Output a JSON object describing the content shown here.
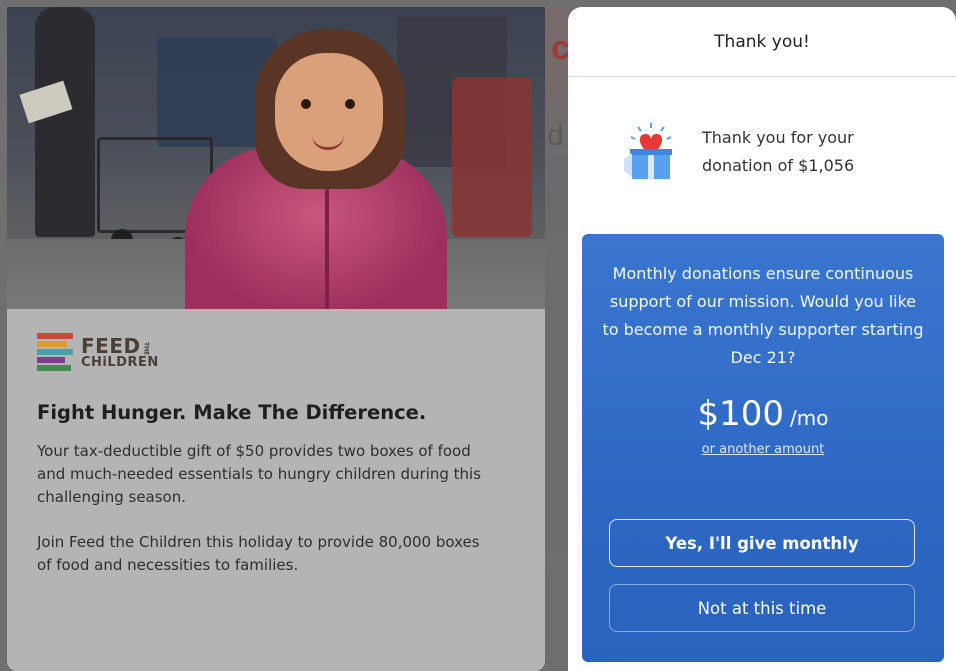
{
  "campaign": {
    "logo": {
      "line1": "FEED",
      "the": "THE",
      "line2": "CHiLDREN"
    },
    "title": "Fight Hunger. Make The Difference.",
    "paragraph1": "Your tax-deductible gift of $50 provides two boxes of food and much-needed essentials to hungry children during this challenging season.",
    "paragraph2": "Join Feed the Children this holiday to provide 80,000 boxes of food and necessities to families."
  },
  "modal": {
    "title": "Thank you!",
    "thanks_line1": "Thank you for your",
    "thanks_line2": "donation of $1,056",
    "upsell": {
      "message": "Monthly donations ensure continuous support of our mission. Would you like to become a monthly supporter starting Dec 21?",
      "amount": "$100",
      "period": "/mo",
      "other_amount_label": "or another amount",
      "yes_label": "Yes, I'll give monthly",
      "no_label": "Not at this time"
    }
  },
  "colors": {
    "logo_stripes": [
      "#c94a3a",
      "#e09a2e",
      "#4aa0a8",
      "#7a3e8c",
      "#3f8c4a"
    ],
    "upsell_bg": "#2e68c4",
    "gift_red": "#e53935",
    "gift_blue": "#5aa0f0"
  }
}
